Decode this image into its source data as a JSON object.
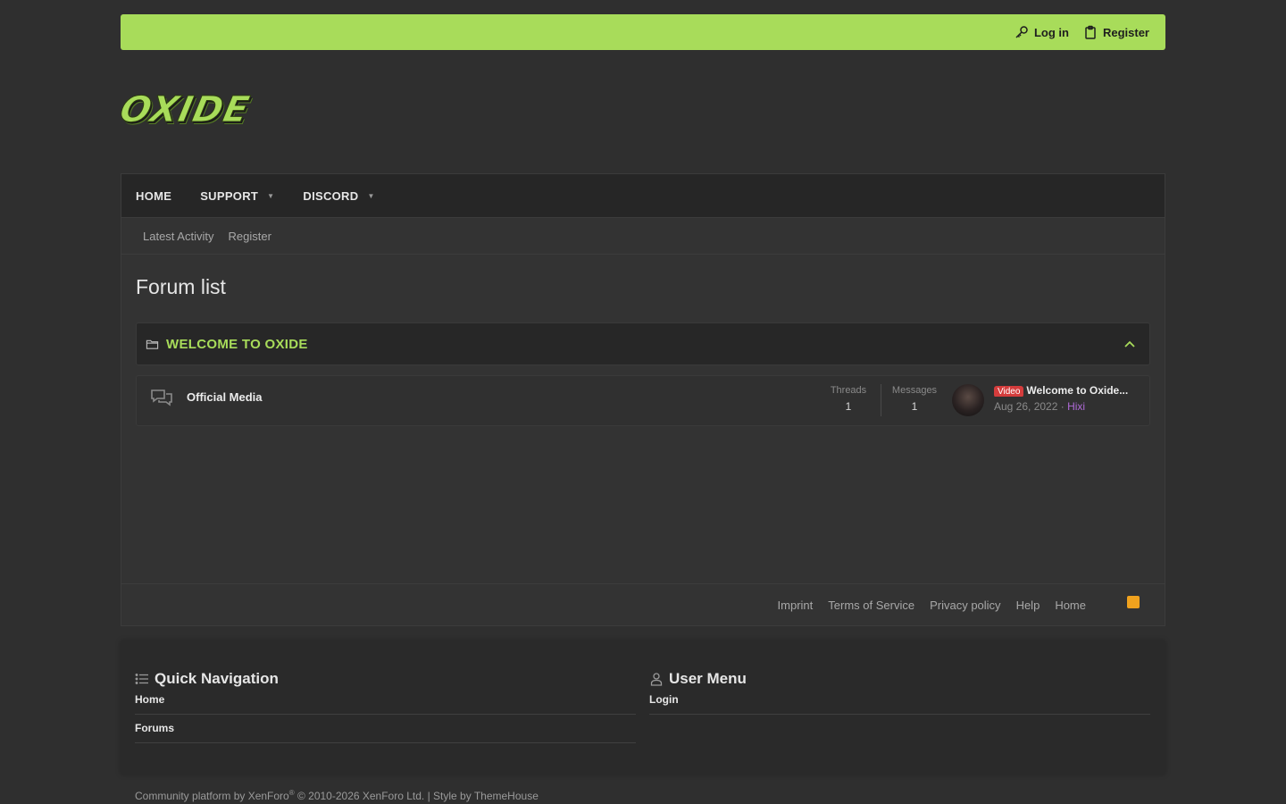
{
  "topbar": {
    "login": "Log in",
    "register": "Register"
  },
  "logo": {
    "text": "OXIDE"
  },
  "nav": {
    "items": [
      {
        "label": "HOME"
      },
      {
        "label": "SUPPORT"
      },
      {
        "label": "DISCORD"
      }
    ]
  },
  "subnav": {
    "latest": "Latest Activity",
    "register": "Register"
  },
  "page": {
    "title": "Forum list"
  },
  "category": {
    "title": "WELCOME TO OXIDE"
  },
  "forum": {
    "name": "Official Media",
    "threads_label": "Threads",
    "threads": "1",
    "messages_label": "Messages",
    "messages": "1",
    "last_badge": "Video",
    "last_title": "Welcome to Oxide...",
    "last_date": "Aug 26, 2022",
    "last_sep": " · ",
    "last_user": "Hixi"
  },
  "footer_links": [
    "Imprint",
    "Terms of Service",
    "Privacy policy",
    "Help",
    "Home"
  ],
  "quick_nav": {
    "title": "Quick Navigation",
    "items": [
      "Home",
      "Forums"
    ]
  },
  "user_menu": {
    "title": "User Menu",
    "items": [
      "Login"
    ]
  },
  "copyright": {
    "prefix": "Community platform by XenForo",
    "reg": "®",
    "suffix": " © 2010-2026 XenForo Ltd. | Style by ThemeHouse"
  },
  "colors": {
    "accent": "#a8dc5a",
    "background": "#2f2f2f",
    "badge": "#d43c3c",
    "user": "#b06ad8",
    "rss": "#f0a21e"
  }
}
